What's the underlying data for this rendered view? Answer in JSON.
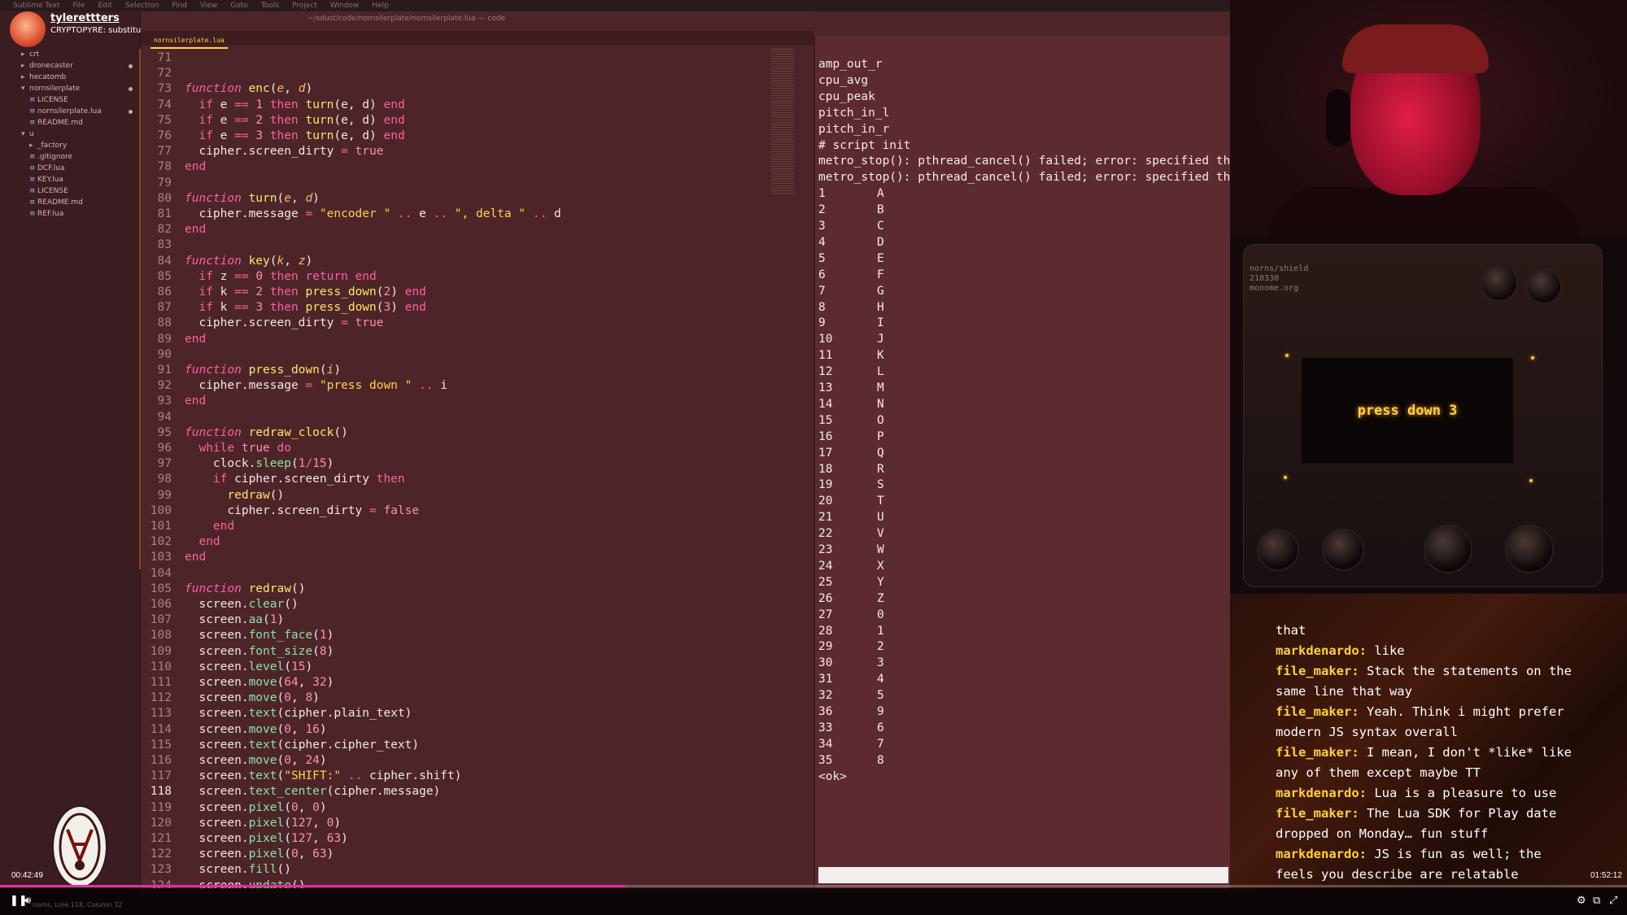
{
  "menubar": {
    "items": [
      "Sublime Text",
      "File",
      "Edit",
      "Selection",
      "Find",
      "View",
      "Goto",
      "Tools",
      "Project",
      "Window",
      "Help"
    ]
  },
  "window": {
    "title": "~/sdust/code/nornsilerplate/nornsilerplate.lua — code"
  },
  "stream": {
    "user": "tylerettters",
    "title": "CRYPTOPYRE: substitution cipher"
  },
  "sidebar": {
    "items": [
      {
        "label": "crt",
        "indent": 1,
        "arrow": "▸",
        "dot": false
      },
      {
        "label": "dronecaster",
        "indent": 1,
        "arrow": "▸",
        "dot": true
      },
      {
        "label": "hecatomb",
        "indent": 1,
        "arrow": "▸",
        "dot": false
      },
      {
        "label": "nornsilerplate",
        "indent": 1,
        "arrow": "▾",
        "dot": true
      },
      {
        "label": "LICENSE",
        "indent": 2,
        "arrow": "",
        "dot": false
      },
      {
        "label": "nornsilerplate.lua",
        "indent": 2,
        "arrow": "",
        "dot": true
      },
      {
        "label": "README.md",
        "indent": 2,
        "arrow": "",
        "dot": false
      },
      {
        "label": "u",
        "indent": 1,
        "arrow": "▾",
        "dot": false
      },
      {
        "label": "_factory",
        "indent": 2,
        "arrow": "▸",
        "dot": false
      },
      {
        "label": ".gitignore",
        "indent": 2,
        "arrow": "",
        "dot": false
      },
      {
        "label": "DCF.lua",
        "indent": 2,
        "arrow": "",
        "dot": false
      },
      {
        "label": "KEY.lua",
        "indent": 2,
        "arrow": "",
        "dot": false
      },
      {
        "label": "LICENSE",
        "indent": 2,
        "arrow": "",
        "dot": false
      },
      {
        "label": "README.md",
        "indent": 2,
        "arrow": "",
        "dot": false
      },
      {
        "label": "REF.lua",
        "indent": 2,
        "arrow": "",
        "dot": false
      }
    ]
  },
  "editor": {
    "tab": "nornsilerplate.lua",
    "active_line": 118,
    "lines": [
      {
        "n": "71",
        "html": ""
      },
      {
        "n": "72",
        "html": ""
      },
      {
        "n": "73",
        "html": "<span class='kwi'>function</span> <span class='fn'>enc</span>(<span class='pa'>e</span>, <span class='pa'>d</span>)"
      },
      {
        "n": "74",
        "html": "  <span class='kw'>if</span> e <span class='op'>==</span> <span class='nu'>1</span> <span class='kw'>then</span> <span class='fn'>turn</span>(e, d) <span class='kw'>end</span>"
      },
      {
        "n": "75",
        "html": "  <span class='kw'>if</span> e <span class='op'>==</span> <span class='nu'>2</span> <span class='kw'>then</span> <span class='fn'>turn</span>(e, d) <span class='kw'>end</span>"
      },
      {
        "n": "76",
        "html": "  <span class='kw'>if</span> e <span class='op'>==</span> <span class='nu'>3</span> <span class='kw'>then</span> <span class='fn'>turn</span>(e, d) <span class='kw'>end</span>"
      },
      {
        "n": "77",
        "html": "  cipher.screen_dirty <span class='op'>=</span> <span class='nu'>true</span>"
      },
      {
        "n": "78",
        "html": "<span class='kw'>end</span>"
      },
      {
        "n": "79",
        "html": ""
      },
      {
        "n": "80",
        "html": "<span class='kwi'>function</span> <span class='fn'>turn</span>(<span class='pa'>e</span>, <span class='pa'>d</span>)"
      },
      {
        "n": "81",
        "html": "  cipher.message <span class='op'>=</span> <span class='st'>\"encoder \"</span> <span class='op'>..</span> e <span class='op'>..</span> <span class='st'>\", delta \"</span> <span class='op'>..</span> d"
      },
      {
        "n": "82",
        "html": "<span class='kw'>end</span>"
      },
      {
        "n": "83",
        "html": ""
      },
      {
        "n": "84",
        "html": "<span class='kwi'>function</span> <span class='fn'>key</span>(<span class='pa'>k</span>, <span class='pa'>z</span>)"
      },
      {
        "n": "85",
        "html": "  <span class='kw'>if</span> z <span class='op'>==</span> <span class='nu'>0</span> <span class='kw'>then return end</span>"
      },
      {
        "n": "86",
        "html": "  <span class='kw'>if</span> k <span class='op'>==</span> <span class='nu'>2</span> <span class='kw'>then</span> <span class='fn'>press_down</span>(<span class='nu'>2</span>) <span class='kw'>end</span>"
      },
      {
        "n": "87",
        "html": "  <span class='kw'>if</span> k <span class='op'>==</span> <span class='nu'>3</span> <span class='kw'>then</span> <span class='fn'>press_down</span>(<span class='nu'>3</span>) <span class='kw'>end</span>"
      },
      {
        "n": "88",
        "html": "  cipher.screen_dirty <span class='op'>=</span> <span class='nu'>true</span>"
      },
      {
        "n": "89",
        "html": "<span class='kw'>end</span>"
      },
      {
        "n": "90",
        "html": ""
      },
      {
        "n": "91",
        "html": "<span class='kwi'>function</span> <span class='fn'>press_down</span>(<span class='pa'>i</span>)"
      },
      {
        "n": "92",
        "html": "  cipher.message <span class='op'>=</span> <span class='st'>\"press down \"</span> <span class='op'>..</span> i"
      },
      {
        "n": "93",
        "html": "<span class='kw'>end</span>"
      },
      {
        "n": "94",
        "html": ""
      },
      {
        "n": "95",
        "html": "<span class='kwi'>function</span> <span class='fn'>redraw_clock</span>()"
      },
      {
        "n": "96",
        "html": "  <span class='kw'>while</span> <span class='nu'>true</span> <span class='kw'>do</span>"
      },
      {
        "n": "97",
        "html": "    clock.<span class='mt'>sleep</span>(<span class='nu'>1</span><span class='op'>/</span><span class='nu'>15</span>)"
      },
      {
        "n": "98",
        "html": "    <span class='kw'>if</span> cipher.screen_dirty <span class='kw'>then</span>"
      },
      {
        "n": "99",
        "html": "      <span class='fn'>redraw</span>()"
      },
      {
        "n": "100",
        "html": "      cipher.screen_dirty <span class='op'>=</span> <span class='nu'>false</span>"
      },
      {
        "n": "101",
        "html": "    <span class='kw'>end</span>"
      },
      {
        "n": "102",
        "html": "  <span class='kw'>end</span>"
      },
      {
        "n": "103",
        "html": "<span class='kw'>end</span>"
      },
      {
        "n": "104",
        "html": ""
      },
      {
        "n": "105",
        "html": "<span class='kwi'>function</span> <span class='fn'>redraw</span>()"
      },
      {
        "n": "106",
        "html": "  screen.<span class='mt'>clear</span>()"
      },
      {
        "n": "107",
        "html": "  screen.<span class='mt'>aa</span>(<span class='nu'>1</span>)"
      },
      {
        "n": "108",
        "html": "  screen.<span class='mt'>font_face</span>(<span class='nu'>1</span>)"
      },
      {
        "n": "109",
        "html": "  screen.<span class='mt'>font_size</span>(<span class='nu'>8</span>)"
      },
      {
        "n": "110",
        "html": "  screen.<span class='mt'>level</span>(<span class='nu'>15</span>)"
      },
      {
        "n": "111",
        "html": "  screen.<span class='mt'>move</span>(<span class='nu'>64</span>, <span class='nu'>32</span>)"
      },
      {
        "n": "112",
        "html": "  screen.<span class='mt'>move</span>(<span class='nu'>0</span>, <span class='nu'>8</span>)"
      },
      {
        "n": "113",
        "html": "  screen.<span class='mt'>text</span>(cipher.plain_text)"
      },
      {
        "n": "114",
        "html": "  screen.<span class='mt'>move</span>(<span class='nu'>0</span>, <span class='nu'>16</span>)"
      },
      {
        "n": "115",
        "html": "  screen.<span class='mt'>text</span>(cipher.cipher_text)"
      },
      {
        "n": "116",
        "html": "  screen.<span class='mt'>move</span>(<span class='nu'>0</span>, <span class='nu'>24</span>)"
      },
      {
        "n": "117",
        "html": "  screen.<span class='mt'>text</span>(<span class='st'>\"SHIFT:\"</span> <span class='op'>..</span> cipher.shift)"
      },
      {
        "n": "118",
        "html": "  screen.<span class='mt'>text_center</span>(cipher.message)"
      },
      {
        "n": "119",
        "html": "  screen.<span class='mt'>pixel</span>(<span class='nu'>0</span>, <span class='nu'>0</span>)"
      },
      {
        "n": "120",
        "html": "  screen.<span class='mt'>pixel</span>(<span class='nu'>127</span>, <span class='nu'>0</span>)"
      },
      {
        "n": "121",
        "html": "  screen.<span class='mt'>pixel</span>(<span class='nu'>127</span>, <span class='nu'>63</span>)"
      },
      {
        "n": "122",
        "html": "  screen.<span class='mt'>pixel</span>(<span class='nu'>0</span>, <span class='nu'>63</span>)"
      },
      {
        "n": "123",
        "html": "  screen.<span class='mt'>fill</span>()"
      },
      {
        "n": "124",
        "html": "  screen.<span class='mt'>update</span>()"
      }
    ]
  },
  "terminal": {
    "header_lines": [
      "amp_out_r",
      "cpu_avg",
      "cpu_peak",
      "pitch_in_l",
      "pitch_in_r",
      "# script init",
      "metro_stop(): pthread_cancel() failed; error: specified thr",
      "metro_stop(): pthread_cancel() failed; error: specified thr"
    ],
    "table": [
      [
        "1",
        "A"
      ],
      [
        "2",
        "B"
      ],
      [
        "3",
        "C"
      ],
      [
        "4",
        "D"
      ],
      [
        "5",
        "E"
      ],
      [
        "6",
        "F"
      ],
      [
        "7",
        "G"
      ],
      [
        "8",
        "H"
      ],
      [
        "9",
        "I"
      ],
      [
        "10",
        "J"
      ],
      [
        "11",
        "K"
      ],
      [
        "12",
        "L"
      ],
      [
        "13",
        "M"
      ],
      [
        "14",
        "N"
      ],
      [
        "15",
        "O"
      ],
      [
        "16",
        "P"
      ],
      [
        "17",
        "Q"
      ],
      [
        "18",
        "R"
      ],
      [
        "19",
        "S"
      ],
      [
        "20",
        "T"
      ],
      [
        "21",
        "U"
      ],
      [
        "22",
        "V"
      ],
      [
        "23",
        "W"
      ],
      [
        "24",
        "X"
      ],
      [
        "25",
        "Y"
      ],
      [
        "26",
        "Z"
      ],
      [
        "27",
        "0"
      ],
      [
        "28",
        "1"
      ],
      [
        "29",
        "2"
      ],
      [
        "30",
        "3"
      ],
      [
        "31",
        "4"
      ],
      [
        "32",
        "5"
      ],
      [
        "36",
        "9"
      ],
      [
        "33",
        "6"
      ],
      [
        "34",
        "7"
      ],
      [
        "35",
        "8"
      ]
    ],
    "footer": "<ok>"
  },
  "device": {
    "label_lines": [
      "norns/shield",
      "210330",
      "monome.org"
    ],
    "screen_message": "press down 3"
  },
  "chat": {
    "lines": [
      {
        "user": "",
        "text": "that"
      },
      {
        "user": "markdenardo:",
        "text": " like"
      },
      {
        "user": "file_maker:",
        "text": " Stack the statements on the"
      },
      {
        "user": "",
        "text": "same line that way"
      },
      {
        "user": "file_maker:",
        "text": " Yeah. Think i might prefer"
      },
      {
        "user": "",
        "text": "modern JS syntax overall"
      },
      {
        "user": "file_maker:",
        "text": " I mean, I don't *like* like"
      },
      {
        "user": "",
        "text": "any of them except maybe TT"
      },
      {
        "user": "markdenardo:",
        "text": " Lua is a pleasure to use"
      },
      {
        "user": "file_maker:",
        "text": " The Lua SDK for Play date"
      },
      {
        "user": "",
        "text": "dropped on Monday… fun stuff"
      },
      {
        "user": "markdenardo:",
        "text": " JS is fun as well; the"
      },
      {
        "user": "",
        "text": "feels you describe are relatable"
      }
    ]
  },
  "player": {
    "elapsed": "00:42:49",
    "total": "01:52:12",
    "progress": 0.384,
    "status": "norns, Line 118, Column 32"
  },
  "colors": {
    "progress": "#e82aa8",
    "device_text": "#ffd23a",
    "chat_user": "#ffd23a"
  }
}
